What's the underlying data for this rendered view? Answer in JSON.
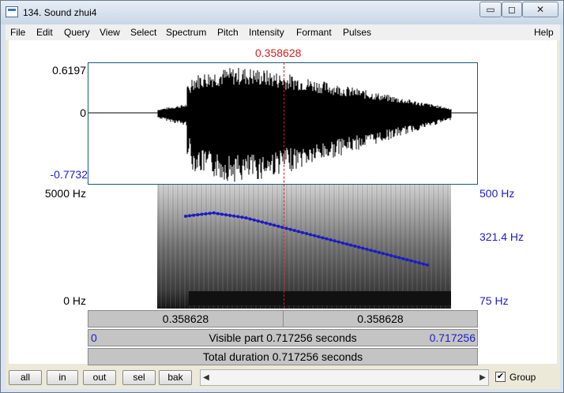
{
  "window": {
    "title": "134. Sound zhui4",
    "buttons": {
      "minimize": "▭",
      "maximize": "◻",
      "close": "✕"
    }
  },
  "menu": {
    "items": [
      "File",
      "Edit",
      "Query",
      "View",
      "Select",
      "Spectrum",
      "Pitch",
      "Intensity",
      "Formant",
      "Pulses"
    ],
    "help": "Help"
  },
  "cursor": {
    "time_label": "0.358628"
  },
  "waveform": {
    "ymax_label": "0.6197",
    "zero_label": "0",
    "ymin_label": "-0.7732"
  },
  "spectrogram": {
    "freq_top_label": "5000 Hz",
    "freq_bottom_label": "0 Hz",
    "pitch_top_label": "500 Hz",
    "pitch_mid_label": "321.4 Hz",
    "pitch_bottom_label": "75 Hz",
    "pitch_color": "#1c1cc4"
  },
  "time_bars": {
    "left_segment": "0.358628",
    "right_segment": "0.358628",
    "visible_start": "0",
    "visible_label": "Visible part 0.717256 seconds",
    "visible_end": "0.717256",
    "total_label": "Total duration 0.717256 seconds"
  },
  "bottom_buttons": [
    "all",
    "in",
    "out",
    "sel",
    "bak"
  ],
  "group": {
    "label": "Group",
    "checked": "✔"
  },
  "scroll": {
    "left_arrow": "◀",
    "right_arrow": "▶"
  }
}
